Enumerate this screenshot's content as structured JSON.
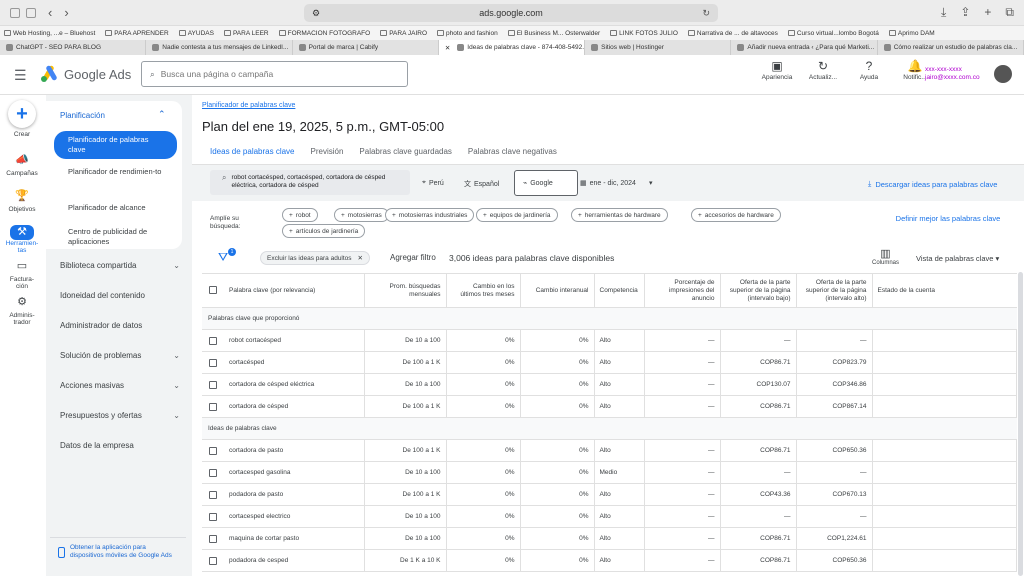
{
  "browser": {
    "url": "ads.google.com",
    "bookmarks": [
      "Web Hosting, ...e – Bluehost",
      "PARA APRENDER",
      "AYUDAS",
      "PARA LEER",
      "FORMACION FOTOGRAFO",
      "PARA JAIRO",
      "photo and fashion",
      "El Business M... Osterwalder",
      "LINK FOTOS JULIO",
      "Narrativa de ... de altavoces",
      "Curso virtual...lombo Bogotá",
      "Aprimo DAM"
    ],
    "tabs": [
      "ChatGPT - SEO PARA BLOG",
      "Nadie contesta a tus mensajes de LinkedI...",
      "Portal de marca | Cabify",
      "Ideas de palabras clave - 874-408-5492...",
      "Sitios web | Hostinger",
      "Añadir nueva entrada ‹ ¿Para qué Marketi...",
      "Cómo realizar un estudio de palabras cla..."
    ],
    "active_tab": 3
  },
  "header": {
    "brand": "Google Ads",
    "search_placeholder": "Busca una página o campaña",
    "icons": [
      {
        "icon": "appearance-icon",
        "label": "Apariencia"
      },
      {
        "icon": "refresh-icon",
        "label": "Actualiz..."
      },
      {
        "icon": "help-icon",
        "label": "Ayuda"
      },
      {
        "icon": "bell-icon",
        "label": "Notific..."
      }
    ],
    "account_line1": "xxx-xxx-xxxx",
    "account_line2": "jairo@xxxx.com.co"
  },
  "rail": [
    {
      "label": "Crear",
      "icon": "plus-icon"
    },
    {
      "label": "Campañas",
      "icon": "megaphone-icon"
    },
    {
      "label": "Objetivos",
      "icon": "trophy-icon"
    },
    {
      "label": "Herramien-tas",
      "icon": "tools-icon",
      "selected": true
    },
    {
      "label": "Factura-ción",
      "icon": "card-icon"
    },
    {
      "label": "Adminis-trador",
      "icon": "gear-icon"
    }
  ],
  "nav": {
    "section": "Planificación",
    "items": [
      "Planificador de palabras clave",
      "Planificador de rendimien-to",
      "Planificador de alcance",
      "Centro de publicidad de aplicaciones"
    ],
    "groups": [
      {
        "label": "Biblioteca compartida",
        "chevron": true
      },
      {
        "label": "Idoneidad del contenido",
        "chevron": false
      },
      {
        "label": "Administrador de datos",
        "chevron": false
      },
      {
        "label": "Solución de problemas",
        "chevron": true
      },
      {
        "label": "Acciones masivas",
        "chevron": true
      },
      {
        "label": "Presupuestos y ofertas",
        "chevron": true
      },
      {
        "label": "Datos de la empresa",
        "chevron": false
      }
    ],
    "app_download": "Obtener la aplicación para dispositivos móviles de Google Ads"
  },
  "main": {
    "breadcrumb": "Planificador de palabras clave",
    "title": "Plan del ene 19, 2025, 5 p.m., GMT-05:00",
    "tabs": [
      "Ideas de palabras clave",
      "Previsión",
      "Palabras clave guardadas",
      "Palabras clave negativas"
    ],
    "keywords_query": "robot cortacésped, cortacésped, cortadora de césped eléctrica, cortadora de césped",
    "location": "Perú",
    "language": "Español",
    "network": "Google",
    "date_range": "ene - dic, 2024",
    "download": "Descargar ideas para palabras clave",
    "broaden_label": "Amplíe su búsqueda:",
    "chips": [
      "robot",
      "motosierras",
      "motosierras industriales",
      "equipos de jardinería",
      "herramientas de hardware",
      "accesorios de hardware",
      "artículos de jardinería"
    ],
    "refine": "Definir mejor las palabras clave",
    "filter_badge": "1",
    "adult_chip": "Excluir las ideas para adultos",
    "add_filter": "Agregar filtro",
    "ideas_count": "3,006 ideas para palabras clave disponibles",
    "columns_label": "Columnas",
    "view": "Vista de palabras clave"
  },
  "table": {
    "headers": [
      "Palabra clave (por relevancia)",
      "Prom. búsquedas mensuales",
      "Cambio en los últimos tres meses",
      "Cambio interanual",
      "Competencia",
      "Porcentaje de impresiones del anuncio",
      "Oferta de la parte superior de la página (intervalo bajo)",
      "Oferta de la parte superior de la página (intervalo alto)",
      "Estado de la cuenta"
    ],
    "group1": "Palabras clave que proporcionó",
    "rows1": [
      [
        "robot cortacésped",
        "De 10 a 100",
        "0%",
        "0%",
        "Alto",
        "—",
        "—",
        "—"
      ],
      [
        "cortacésped",
        "De 100 a 1 K",
        "0%",
        "0%",
        "Alto",
        "—",
        "COP86.71",
        "COP823.79"
      ],
      [
        "cortadora de césped eléctrica",
        "De 10 a 100",
        "0%",
        "0%",
        "Alto",
        "—",
        "COP130.07",
        "COP346.86"
      ],
      [
        "cortadora de césped",
        "De 100 a 1 K",
        "0%",
        "0%",
        "Alto",
        "—",
        "COP86.71",
        "COP867.14"
      ]
    ],
    "group2": "Ideas de palabras clave",
    "rows2": [
      [
        "cortadora de pasto",
        "De 100 a 1 K",
        "0%",
        "0%",
        "Alto",
        "—",
        "COP86.71",
        "COP650.36"
      ],
      [
        "cortacesped gasolina",
        "De 10 a 100",
        "0%",
        "0%",
        "Medio",
        "—",
        "—",
        "—"
      ],
      [
        "podadora de pasto",
        "De 100 a 1 K",
        "0%",
        "0%",
        "Alto",
        "—",
        "COP43.36",
        "COP670.13"
      ],
      [
        "cortacesped electrico",
        "De 10 a 100",
        "0%",
        "0%",
        "Alto",
        "—",
        "—",
        "—"
      ],
      [
        "maquina de cortar pasto",
        "De 10 a 100",
        "0%",
        "0%",
        "Alto",
        "—",
        "COP86.71",
        "COP1,224.61"
      ],
      [
        "podadora de cesped",
        "De 1 K a 10 K",
        "0%",
        "0%",
        "Alto",
        "—",
        "COP86.71",
        "COP650.36"
      ]
    ]
  }
}
